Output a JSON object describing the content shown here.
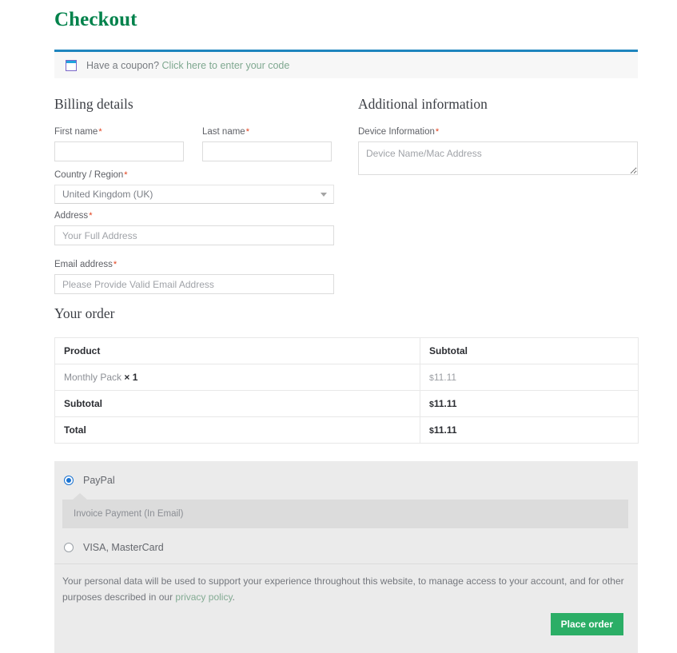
{
  "page": {
    "title": "Checkout"
  },
  "coupon": {
    "icon": "coupon-tag-icon",
    "text": "Have a coupon?",
    "link_label": "Click here to enter your code",
    "accent_border": "#1e85be",
    "bar_background": "#f7f7f7"
  },
  "billing": {
    "heading": "Billing details",
    "fields": {
      "first_name": {
        "label": "First name",
        "required_mark": "*",
        "value": "",
        "placeholder": ""
      },
      "last_name": {
        "label": "Last name",
        "required_mark": "*",
        "value": "",
        "placeholder": ""
      },
      "country": {
        "label": "Country / Region",
        "required_mark": "*",
        "selected": "United Kingdom (UK)"
      },
      "address": {
        "label": "Address",
        "required_mark": "*",
        "value": "",
        "placeholder": "Your Full Address"
      },
      "email": {
        "label": "Email address",
        "required_mark": "*",
        "value": "",
        "placeholder": "Please Provide Valid Email Address"
      }
    }
  },
  "additional": {
    "heading": "Additional information",
    "device": {
      "label": "Device Information",
      "required_mark": "*",
      "value": "",
      "placeholder": "Device Name/Mac Address"
    }
  },
  "order": {
    "heading": "Your order",
    "columns": [
      "Product",
      "Subtotal"
    ],
    "items": [
      {
        "name": "Monthly Pack",
        "qty": "× 1",
        "amount_currency": "$",
        "amount_value": "11.11"
      }
    ],
    "summary": [
      {
        "label": "Subtotal",
        "amount_currency": "$",
        "amount_value": "11.11"
      },
      {
        "label": "Total",
        "amount_currency": "$",
        "amount_value": "11.11"
      }
    ]
  },
  "payment": {
    "methods": [
      {
        "label": "PayPal",
        "selected": true,
        "description": "Invoice Payment (In Email)"
      },
      {
        "label": "VISA, MasterCard",
        "selected": false
      }
    ],
    "privacy_text_before": "Your personal data will be used to support your experience throughout this website, to manage access to your account, and for other purposes described in our ",
    "privacy_link": "privacy policy",
    "privacy_text_after": ".",
    "place_order_label": "Place order",
    "button_color": "#2bae66"
  }
}
